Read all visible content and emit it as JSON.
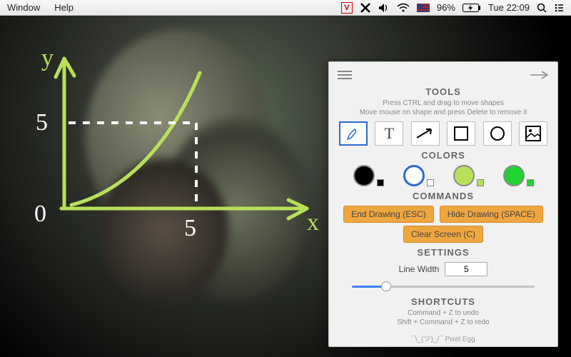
{
  "menubar": {
    "items": [
      "Window",
      "Help"
    ],
    "battery": "96%",
    "clock": "Tue 22:09",
    "v_label": "V"
  },
  "sketch": {
    "y_label": "y",
    "x_label": "x",
    "origin": "0",
    "tick_y": "5",
    "tick_x": "5"
  },
  "panel": {
    "tools_title": "TOOLS",
    "hint1": "Press CTRL and drag to move shapes",
    "hint2": "Move mouse on shape and press Delete to remove it",
    "colors_title": "COLORS",
    "colors": [
      {
        "hex": "#000000",
        "selected": false
      },
      {
        "hex": "#ffffff",
        "selected": true
      },
      {
        "hex": "#b7e05a",
        "selected": false
      },
      {
        "hex": "#1fd431",
        "selected": false
      }
    ],
    "commands_title": "COMMANDS",
    "cmd_end": "End Drawing (ESC)",
    "cmd_hide": "Hide Drawing (SPACE)",
    "cmd_clear": "Clear Screen (C)",
    "settings_title": "SETTINGS",
    "line_width_label": "Line Width",
    "line_width_value": "5",
    "shortcuts_title": "SHORTCUTS",
    "sc1": "Command + Z to undo",
    "sc2": "Shift + Command + Z to redo",
    "footer": "¯\\_(ツ)_/¯  Pixel Egg"
  }
}
